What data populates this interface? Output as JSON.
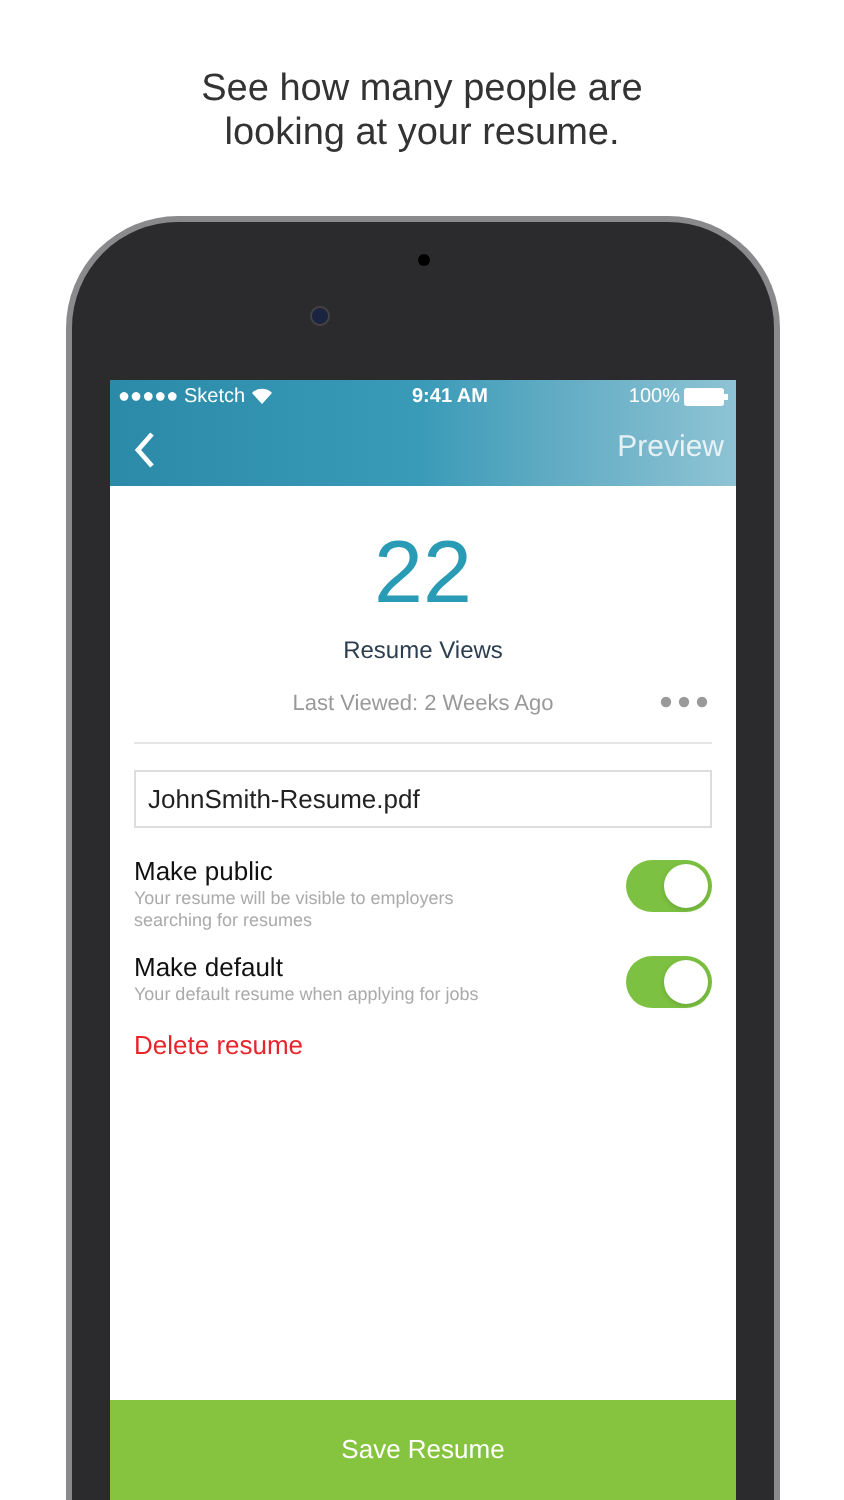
{
  "caption": "See how many people are looking at your resume.",
  "status_bar": {
    "carrier": "●●●●● Sketch",
    "time": "9:41 AM",
    "battery": "100%"
  },
  "nav": {
    "action": "Preview"
  },
  "stats": {
    "count": "22",
    "label": "Resume Views",
    "last_viewed": "Last Viewed: 2 Weeks Ago"
  },
  "file_field": {
    "value": "JohnSmith-Resume.pdf"
  },
  "settings": [
    {
      "title": "Make public",
      "description": "Your resume will be visible to employers searching for resumes",
      "on": true
    },
    {
      "title": "Make default",
      "description": "Your default resume when applying for jobs",
      "on": true
    }
  ],
  "delete_link": "Delete resume",
  "save_button": "Save Resume"
}
